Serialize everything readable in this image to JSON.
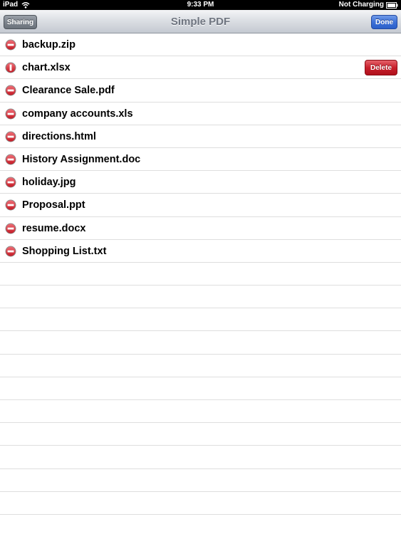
{
  "status_bar": {
    "device": "iPad",
    "time": "9:33 PM",
    "battery": "Not Charging"
  },
  "nav": {
    "title": "Simple PDF",
    "left_button": "Sharing",
    "right_button": "Done"
  },
  "files": [
    {
      "name": "backup.zip",
      "state": "minus"
    },
    {
      "name": "chart.xlsx",
      "state": "delete-confirm",
      "delete_label": "Delete"
    },
    {
      "name": "Clearance Sale.pdf",
      "state": "minus"
    },
    {
      "name": "company accounts.xls",
      "state": "minus"
    },
    {
      "name": "directions.html",
      "state": "minus"
    },
    {
      "name": "History Assignment.doc",
      "state": "minus"
    },
    {
      "name": "holiday.jpg",
      "state": "minus"
    },
    {
      "name": "Proposal.ppt",
      "state": "minus"
    },
    {
      "name": "resume.docx",
      "state": "minus"
    },
    {
      "name": "Shopping List.txt",
      "state": "minus"
    }
  ],
  "empty_rows": 12,
  "colors": {
    "delete_red": "#c8202c",
    "done_blue": "#3f72d8",
    "minus_red": "#c41a25"
  },
  "icons": {
    "minus": "minus-circle-icon",
    "rotated": "rotated-minus-icon",
    "wifi": "wifi-icon",
    "battery": "battery-icon"
  }
}
